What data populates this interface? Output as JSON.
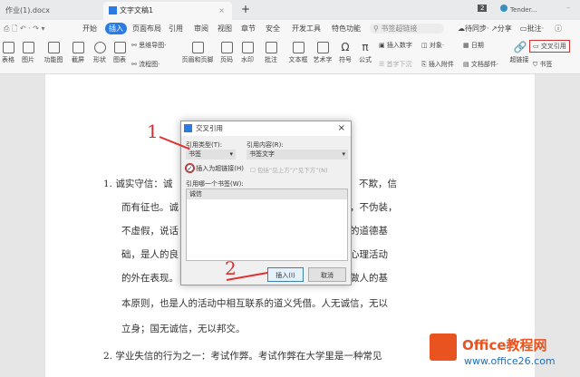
{
  "tabs": [
    {
      "label": "作业(1).docx"
    },
    {
      "label": "文字文稿1"
    }
  ],
  "new_tab": "+",
  "window": {
    "badge": "2",
    "user": "Tender..."
  },
  "menu": [
    "开始",
    "插入",
    "页面布局",
    "引用",
    "审阅",
    "视图",
    "章节",
    "安全",
    "开发工具",
    "特色功能"
  ],
  "search_placeholder": "书签超链接",
  "menu_right": {
    "sync": "待同步",
    "share": "分享",
    "comment": "批注"
  },
  "ribbon": {
    "table": "表格",
    "picture": "图片",
    "function_chart": "功能图",
    "screenshot": "截屏",
    "shape": "形状",
    "chart": "图表",
    "mindmap": "思维导图",
    "flowchart": "流程图",
    "header_footer": "页眉和页脚",
    "page_num": "页码",
    "watermark": "水印",
    "comment": "批注",
    "textbox": "文本框",
    "wordart": "艺术字",
    "symbol": "符号",
    "formula": "公式",
    "insert_number": "插入数字",
    "object": "对象",
    "date": "日期",
    "dropcap": "首字下沉",
    "attachment": "插入附件",
    "doc_parts": "文档部件",
    "hyperlink": "超链接",
    "crossref": "交叉引用",
    "bookmark": "书签"
  },
  "document": {
    "lines": [
      {
        "left": "1. 诚实守信：诚",
        "right": "不欺，信"
      },
      {
        "left": "而有征也。诚",
        "right": "，不伪装，"
      },
      {
        "left": "不虚假，说话",
        "right": "的道德基"
      },
      {
        "left": "础，是人的良",
        "right": "心理活动"
      },
      {
        "left": "的外在表现。",
        "right": "做人的基"
      },
      {
        "left": "本原则，也是人的活动中相互联系的道义凭借。人无诚信，无以",
        "right": ""
      },
      {
        "left": "立身；国无诚信，无以邦交。",
        "right": ""
      },
      {
        "left": "2. 学业失信的行为之一：考试作弊。考试作弊在大学里是一种常见",
        "right": ""
      }
    ]
  },
  "dialog": {
    "title": "交叉引用",
    "type_label": "引用类型(T):",
    "type_value": "书签",
    "content_label": "引用内容(R):",
    "content_value": "书签文字",
    "hyperlink_label": "插入为超链接(H)",
    "hyperlink_checked": true,
    "include_label": "包括“见上方”/“见下方”(N)",
    "which_label": "引用哪一个书签(W):",
    "items": [
      "诚信"
    ],
    "insert": "插入(I)",
    "cancel": "取消"
  },
  "annotations": {
    "step1": "1",
    "step2": "2"
  },
  "watermark": {
    "brand": "Office教程网",
    "url": "www.office26.com"
  }
}
